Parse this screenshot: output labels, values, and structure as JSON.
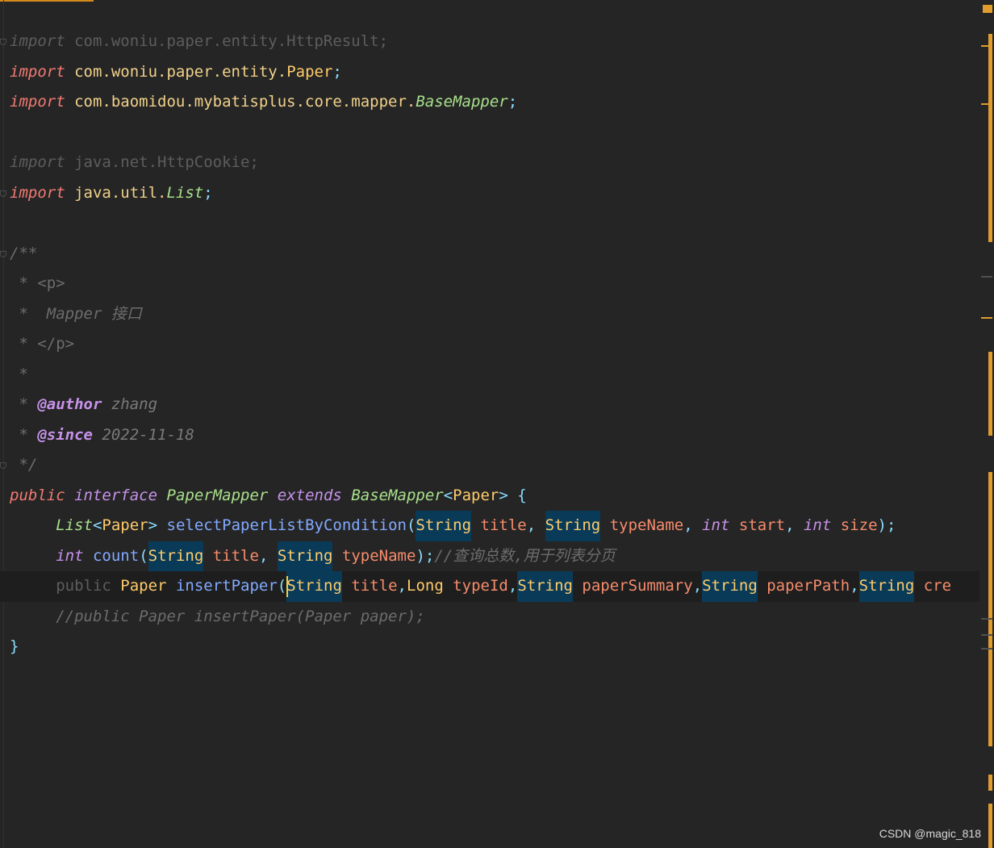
{
  "editor": {
    "lines": [
      {
        "fold": true,
        "tokens": [
          {
            "t": "import",
            "c": "kw dim"
          },
          {
            "t": " com.woniu.paper.entity.HttpResult;",
            "c": "dim"
          }
        ]
      },
      {
        "tokens": [
          {
            "t": "import",
            "c": "kw"
          },
          {
            "t": " com.woniu.paper.entity.",
            "c": "pkg"
          },
          {
            "t": "Paper",
            "c": "cls"
          },
          {
            "t": ";",
            "c": "punc"
          }
        ]
      },
      {
        "tokens": [
          {
            "t": "import",
            "c": "kw"
          },
          {
            "t": " com.baomidou.mybatisplus.core.mapper.",
            "c": "pkg"
          },
          {
            "t": "BaseMapper",
            "c": "iface"
          },
          {
            "t": ";",
            "c": "punc"
          }
        ]
      },
      {
        "tokens": []
      },
      {
        "tokens": [
          {
            "t": "import",
            "c": "kw dim"
          },
          {
            "t": " java.net.HttpCookie;",
            "c": "dim"
          }
        ]
      },
      {
        "fold": true,
        "tokens": [
          {
            "t": "import",
            "c": "kw"
          },
          {
            "t": " java.util.",
            "c": "pkg"
          },
          {
            "t": "List",
            "c": "iface"
          },
          {
            "t": ";",
            "c": "punc"
          }
        ]
      },
      {
        "tokens": []
      },
      {
        "fold": true,
        "tokens": [
          {
            "t": "/**",
            "c": "cmt"
          }
        ]
      },
      {
        "tokens": [
          {
            "t": " * <p>",
            "c": "doc"
          }
        ]
      },
      {
        "tokens": [
          {
            "t": " *  Mapper ",
            "c": "cmt"
          },
          {
            "t": "接口",
            "c": "cmt"
          }
        ]
      },
      {
        "tokens": [
          {
            "t": " * </p>",
            "c": "doc"
          }
        ]
      },
      {
        "tokens": [
          {
            "t": " *",
            "c": "cmt"
          }
        ]
      },
      {
        "tokens": [
          {
            "t": " * ",
            "c": "cmt"
          },
          {
            "t": "@author",
            "c": "tag"
          },
          {
            "t": " zhang",
            "c": "docval"
          }
        ]
      },
      {
        "tokens": [
          {
            "t": " * ",
            "c": "cmt"
          },
          {
            "t": "@since",
            "c": "tag"
          },
          {
            "t": " 2022-11-18",
            "c": "docval"
          }
        ]
      },
      {
        "fold": true,
        "tokens": [
          {
            "t": " */",
            "c": "cmt"
          }
        ]
      },
      {
        "tokens": [
          {
            "t": "public",
            "c": "kw"
          },
          {
            "t": " ",
            "c": "plain"
          },
          {
            "t": "interface",
            "c": "kw2"
          },
          {
            "t": " ",
            "c": "plain"
          },
          {
            "t": "PaperMapper",
            "c": "iface"
          },
          {
            "t": " ",
            "c": "plain"
          },
          {
            "t": "extends",
            "c": "kw2"
          },
          {
            "t": " ",
            "c": "plain"
          },
          {
            "t": "BaseMapper",
            "c": "iface"
          },
          {
            "t": "<",
            "c": "punc"
          },
          {
            "t": "Paper",
            "c": "cls"
          },
          {
            "t": ">",
            "c": "punc"
          },
          {
            "t": " {",
            "c": "punc"
          }
        ]
      },
      {
        "tokens": [
          {
            "t": "     ",
            "c": "indent"
          },
          {
            "t": "List",
            "c": "iface"
          },
          {
            "t": "<",
            "c": "punc"
          },
          {
            "t": "Paper",
            "c": "cls"
          },
          {
            "t": ">",
            "c": "punc"
          },
          {
            "t": " ",
            "c": "plain"
          },
          {
            "t": "selectPaperListByCondition",
            "c": "fn"
          },
          {
            "t": "(",
            "c": "punc"
          },
          {
            "t": "String",
            "c": "cls hl"
          },
          {
            "t": " ",
            "c": "plain"
          },
          {
            "t": "title",
            "c": "param"
          },
          {
            "t": ", ",
            "c": "punc"
          },
          {
            "t": "String",
            "c": "cls hl"
          },
          {
            "t": " ",
            "c": "plain"
          },
          {
            "t": "typeName",
            "c": "param"
          },
          {
            "t": ", ",
            "c": "punc"
          },
          {
            "t": "int",
            "c": "kw2"
          },
          {
            "t": " ",
            "c": "plain"
          },
          {
            "t": "start",
            "c": "param"
          },
          {
            "t": ", ",
            "c": "punc"
          },
          {
            "t": "int",
            "c": "kw2"
          },
          {
            "t": " ",
            "c": "plain"
          },
          {
            "t": "size",
            "c": "param"
          },
          {
            "t": ");",
            "c": "punc"
          }
        ]
      },
      {
        "tokens": [
          {
            "t": "     ",
            "c": "indent"
          },
          {
            "t": "int",
            "c": "kw2"
          },
          {
            "t": " ",
            "c": "plain"
          },
          {
            "t": "count",
            "c": "fn"
          },
          {
            "t": "(",
            "c": "punc"
          },
          {
            "t": "String",
            "c": "cls hl"
          },
          {
            "t": " ",
            "c": "plain"
          },
          {
            "t": "title",
            "c": "param"
          },
          {
            "t": ", ",
            "c": "punc"
          },
          {
            "t": "String",
            "c": "cls hl"
          },
          {
            "t": " ",
            "c": "plain"
          },
          {
            "t": "typeName",
            "c": "param"
          },
          {
            "t": ");",
            "c": "punc"
          },
          {
            "t": "//查询总数,用于列表分页",
            "c": "cmt"
          }
        ]
      },
      {
        "current": true,
        "tokens": [
          {
            "t": "     ",
            "c": "indent"
          },
          {
            "t": "public",
            "c": "dim"
          },
          {
            "t": " ",
            "c": "plain"
          },
          {
            "t": "Paper",
            "c": "cls"
          },
          {
            "t": " ",
            "c": "plain"
          },
          {
            "t": "insertPaper",
            "c": "fn"
          },
          {
            "t": "(",
            "c": "punc"
          },
          {
            "t": "String",
            "c": "cls hl"
          },
          {
            "t": " ",
            "c": "plain"
          },
          {
            "t": "title",
            "c": "param"
          },
          {
            "t": ",",
            "c": "punc"
          },
          {
            "t": "Long",
            "c": "cls"
          },
          {
            "t": " ",
            "c": "plain"
          },
          {
            "t": "typeId",
            "c": "param"
          },
          {
            "t": ",",
            "c": "punc"
          },
          {
            "t": "String",
            "c": "cls hl"
          },
          {
            "t": " ",
            "c": "plain"
          },
          {
            "t": "paperSummary",
            "c": "param"
          },
          {
            "t": ",",
            "c": "punc"
          },
          {
            "t": "String",
            "c": "cls hl"
          },
          {
            "t": " ",
            "c": "plain"
          },
          {
            "t": "paperPath",
            "c": "param"
          },
          {
            "t": ",",
            "c": "punc"
          },
          {
            "t": "String",
            "c": "cls hl"
          },
          {
            "t": " ",
            "c": "plain"
          },
          {
            "t": "cre",
            "c": "param"
          }
        ]
      },
      {
        "tokens": [
          {
            "t": "     ",
            "c": "indent"
          },
          {
            "t": "//public Paper insertPaper(Paper paper);",
            "c": "cmt"
          }
        ]
      },
      {
        "tokens": [
          {
            "t": "}",
            "c": "punc"
          }
        ]
      }
    ]
  },
  "watermark": "CSDN @magic_818",
  "colors": {
    "background": "#252525",
    "accent": "#e09c2c",
    "selection": "#093b59"
  }
}
